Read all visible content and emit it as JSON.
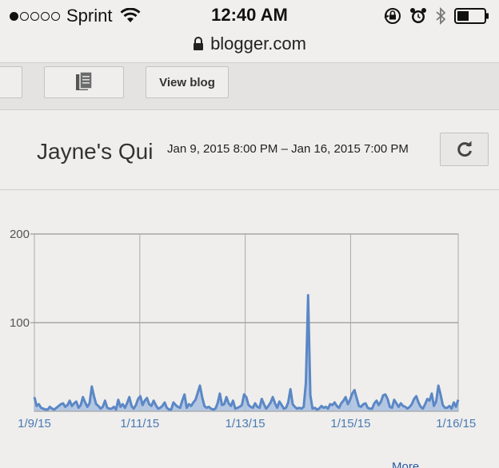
{
  "status_bar": {
    "carrier": "Sprint",
    "signal_bars_filled": 1,
    "signal_bars_total": 5,
    "time": "12:40 AM",
    "icons": [
      "orientation-lock-icon",
      "alarm-icon",
      "bluetooth-icon",
      "battery-icon"
    ]
  },
  "browser": {
    "url": "blogger.com"
  },
  "toolbar": {
    "view_blog_label": "View blog"
  },
  "header": {
    "blog_title": "Jayne's Quilting Room",
    "date_range": "Jan 9, 2015 8:00 PM – Jan 16, 2015 7:00 PM"
  },
  "chart_data": {
    "type": "area",
    "title": "",
    "xlabel": "",
    "ylabel": "",
    "ylim": [
      0,
      200
    ],
    "y_ticks": [
      "200",
      "100"
    ],
    "x_tick_labels": [
      "1/9/15",
      "1/11/15",
      "1/13/15",
      "1/15/15",
      "1/16/15"
    ],
    "x_tick_hours": [
      0,
      48,
      96,
      144,
      192
    ],
    "x_range_hours": [
      0,
      193
    ],
    "grid": true,
    "series": [
      {
        "color": "#5b87c5",
        "fill": "#a9c0e0",
        "hourly_views": [
          16,
          6,
          8,
          4,
          3,
          2,
          2,
          5,
          3,
          2,
          4,
          6,
          8,
          9,
          5,
          7,
          12,
          6,
          9,
          11,
          4,
          7,
          16,
          10,
          5,
          9,
          28,
          17,
          8,
          6,
          3,
          5,
          12,
          4,
          3,
          3,
          5,
          2,
          13,
          5,
          8,
          4,
          9,
          16,
          6,
          3,
          7,
          14,
          17,
          7,
          12,
          15,
          8,
          6,
          12,
          7,
          3,
          4,
          6,
          10,
          4,
          2,
          2,
          10,
          7,
          5,
          4,
          12,
          19,
          4,
          8,
          6,
          10,
          13,
          21,
          29,
          16,
          6,
          4,
          5,
          3,
          2,
          3,
          9,
          20,
          7,
          8,
          16,
          9,
          6,
          12,
          3,
          4,
          5,
          7,
          19,
          16,
          7,
          5,
          4,
          9,
          5,
          4,
          14,
          8,
          3,
          6,
          10,
          16,
          9,
          4,
          11,
          7,
          3,
          4,
          10,
          25,
          8,
          5,
          3,
          4,
          3,
          5,
          32,
          131,
          18,
          3,
          4,
          2,
          3,
          6,
          4,
          5,
          3,
          8,
          7,
          10,
          6,
          4,
          9,
          12,
          16,
          8,
          13,
          20,
          24,
          15,
          6,
          5,
          8,
          9,
          4,
          3,
          3,
          9,
          12,
          7,
          11,
          18,
          19,
          14,
          5,
          4,
          13,
          9,
          5,
          9,
          6,
          5,
          3,
          5,
          8,
          14,
          17,
          10,
          5,
          3,
          8,
          14,
          12,
          20,
          6,
          11,
          29,
          19,
          7,
          4,
          4,
          6,
          3,
          10,
          5,
          13
        ]
      }
    ]
  },
  "footer": {
    "more_link": "More"
  }
}
